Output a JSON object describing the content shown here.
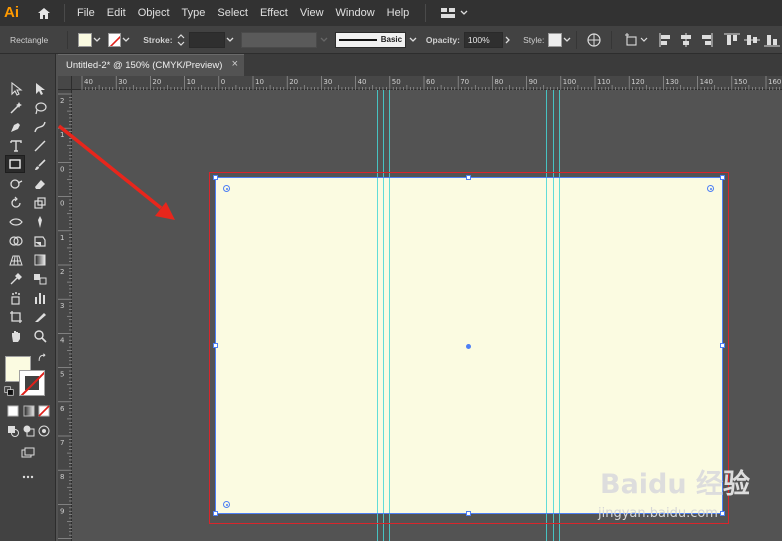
{
  "app": {
    "logo": "Ai"
  },
  "menu": [
    "File",
    "Edit",
    "Object",
    "Type",
    "Select",
    "Effect",
    "View",
    "Window",
    "Help"
  ],
  "control_bar": {
    "tool_name": "Rectangle",
    "stroke_label": "Stroke:",
    "brush_label": "Basic",
    "opacity_label": "Opacity:",
    "opacity_value": "100%",
    "style_label": "Style:"
  },
  "document": {
    "tab_title": "Untitled-2* @ 150% (CMYK/Preview)",
    "close_glyph": "×"
  },
  "ruler": {
    "horizontal_ticks": [
      "40",
      "30",
      "20",
      "10",
      "0",
      "10",
      "20",
      "30",
      "40",
      "50",
      "60",
      "70",
      "80",
      "90",
      "100",
      "110",
      "120",
      "130",
      "140",
      "150",
      "160"
    ],
    "vertical_ticks": [
      "2",
      "1",
      "0",
      "0",
      "1",
      "2",
      "3",
      "4",
      "5",
      "6",
      "7",
      "8",
      "9",
      "1"
    ]
  },
  "colors": {
    "artboard_fill": "#fbfbe1",
    "artboard_border": "#d9252b",
    "selection": "#4d7ff5",
    "guides": "#45d6d6",
    "annotation_arrow": "#e8261c"
  },
  "watermark": {
    "brand": "Baidu 经验",
    "url": "jingyan.baidu.com"
  }
}
